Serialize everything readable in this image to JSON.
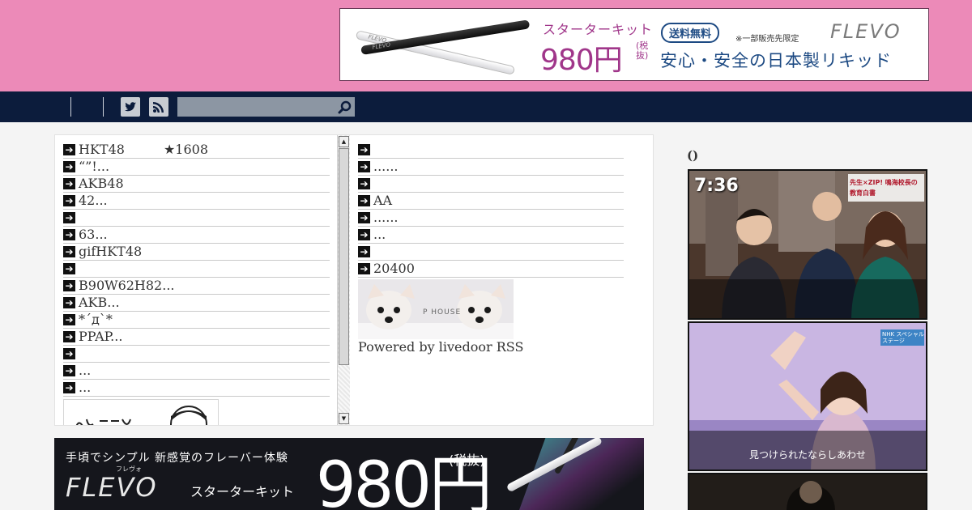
{
  "top_ad": {
    "pen_brand": "FLEVO",
    "product": "スターターキット",
    "price": "980円",
    "tax_note": "(税抜)",
    "shipping_badge": "送料無料",
    "limited_note": "※一部販売先限定",
    "brand": "FLEVO",
    "slogan": "安心・安全の日本製リキッド"
  },
  "nav": {
    "twitter_icon": "twitter-icon",
    "rss_icon": "rss-icon",
    "search_placeholder": "",
    "search_icon": "search-icon"
  },
  "feed": {
    "left_items": [
      {
        "text": "HKT48",
        "extra": "★1608"
      },
      {
        "text": "“”!..."
      },
      {
        "text": "AKB48"
      },
      {
        "text": "42..."
      },
      {
        "text": ""
      },
      {
        "text": "63..."
      },
      {
        "text": "gifHKT48"
      },
      {
        "text": ""
      },
      {
        "text": "B90W62H82..."
      },
      {
        "text": "AKB..."
      },
      {
        "text": "*´д`*"
      },
      {
        "text": "PPAP..."
      },
      {
        "text": ""
      },
      {
        "text": "..."
      },
      {
        "text": "..."
      }
    ],
    "right_items": [
      {
        "text": ""
      },
      {
        "text": "......"
      },
      {
        "text": ""
      },
      {
        "text": "AA"
      },
      {
        "text": "......"
      },
      {
        "text": "..."
      },
      {
        "text": ""
      },
      {
        "text": "20400"
      }
    ],
    "dog_banner_text": "P HOUSE",
    "powered_by": "Powered by livedoor RSS"
  },
  "bottom_ad": {
    "tagline": "手頃でシンプル 新感覚のフレーバー体験",
    "reading": "フレヴォ",
    "brand": "FLEVO",
    "product": "スターターキット",
    "price": "980円",
    "tax_note": "(税抜)"
  },
  "sidebar": {
    "title": "()",
    "thumbs": [
      {
        "clock": "7:36",
        "headline": "先生×ZIP! 鳴海校長の教育白書",
        "caption": ""
      },
      {
        "headline": "NHK スペシャルステージ",
        "caption": "見つけられたならしあわせ"
      },
      {
        "caption": ""
      }
    ]
  },
  "colors": {
    "header_pink": "#ec8ab8",
    "nav_navy": "#0c1c3c",
    "ad_purple": "#a0368a",
    "ad_blue": "#1d4a83"
  }
}
